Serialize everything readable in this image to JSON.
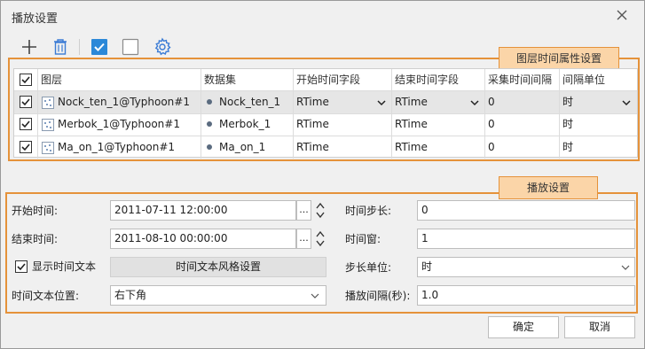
{
  "window": {
    "title": "播放设置"
  },
  "toolbar": {
    "add": "add-icon",
    "delete": "trash-icon",
    "select_all": "checkbox-checked-icon",
    "select_none": "checkbox-empty-icon",
    "settings": "gear-icon"
  },
  "annotations": {
    "layer_panel": "图层时间属性设置",
    "play_panel": "播放设置"
  },
  "table": {
    "headers": [
      "图层",
      "数据集",
      "开始时间字段",
      "结束时间字段",
      "采集时间间隔",
      "间隔单位"
    ],
    "rows": [
      {
        "checked": true,
        "layer": "Nock_ten_1@Typhoon#1",
        "dataset": "Nock_ten_1",
        "start_field": "RTime",
        "end_field": "RTime",
        "interval": "0",
        "unit": "时"
      },
      {
        "checked": true,
        "layer": "Merbok_1@Typhoon#1",
        "dataset": "Merbok_1",
        "start_field": "RTime",
        "end_field": "RTime",
        "interval": "0",
        "unit": "时"
      },
      {
        "checked": true,
        "layer": "Ma_on_1@Typhoon#1",
        "dataset": "Ma_on_1",
        "start_field": "RTime",
        "end_field": "RTime",
        "interval": "0",
        "unit": "时"
      }
    ]
  },
  "form": {
    "start_time_label": "开始时间:",
    "start_time": "2011-07-11 12:00:00",
    "end_time_label": "结束时间:",
    "end_time": "2011-08-10 00:00:00",
    "ellipsis": "...",
    "show_time_text_label": "显示时间文本",
    "show_time_text_checked": true,
    "time_text_style_button": "时间文本风格设置",
    "time_text_position_label": "时间文本位置:",
    "time_text_position": "右下角",
    "time_step_label": "时间步长:",
    "time_step": "0",
    "time_window_label": "时间窗:",
    "time_window": "1",
    "step_unit_label": "步长单位:",
    "step_unit": "时",
    "play_interval_label": "播放间隔(秒):",
    "play_interval": "1.0"
  },
  "footer": {
    "ok": "确定",
    "cancel": "取消"
  },
  "colors": {
    "accent": "#2b88d8",
    "annotation_border": "#e5923a",
    "annotation_fill": "#fbd5a8"
  }
}
